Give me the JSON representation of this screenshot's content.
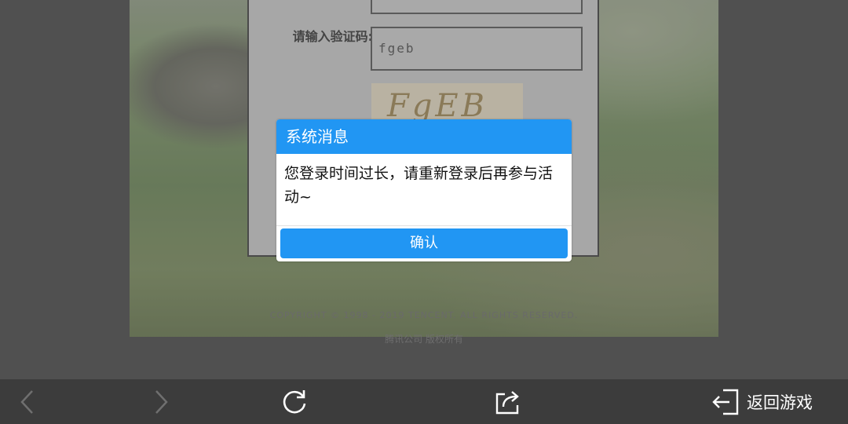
{
  "login": {
    "captcha_label": "请输入验证码:",
    "captcha_value": "fgeb",
    "captcha_image_text": "FgEB"
  },
  "dialog": {
    "title": "系统消息",
    "message": "您登录时间过长，请重新登录后再参与活动~",
    "confirm_label": "确认"
  },
  "footer": {
    "copyright": "COPYRIGHT © 1998 - 2019 TENCENT. ALL RIGHTS RESERVED.",
    "company": "腾讯公司 版权所有"
  },
  "toolbar": {
    "back_icon": "chevron-left-icon",
    "forward_icon": "chevron-right-icon",
    "refresh_icon": "refresh-icon",
    "share_icon": "share-icon",
    "exit_label": "返回游戏"
  },
  "colors": {
    "accent": "#2196f3",
    "toolbar_bg": "#3c3c3c",
    "page_bg": "#505050"
  }
}
